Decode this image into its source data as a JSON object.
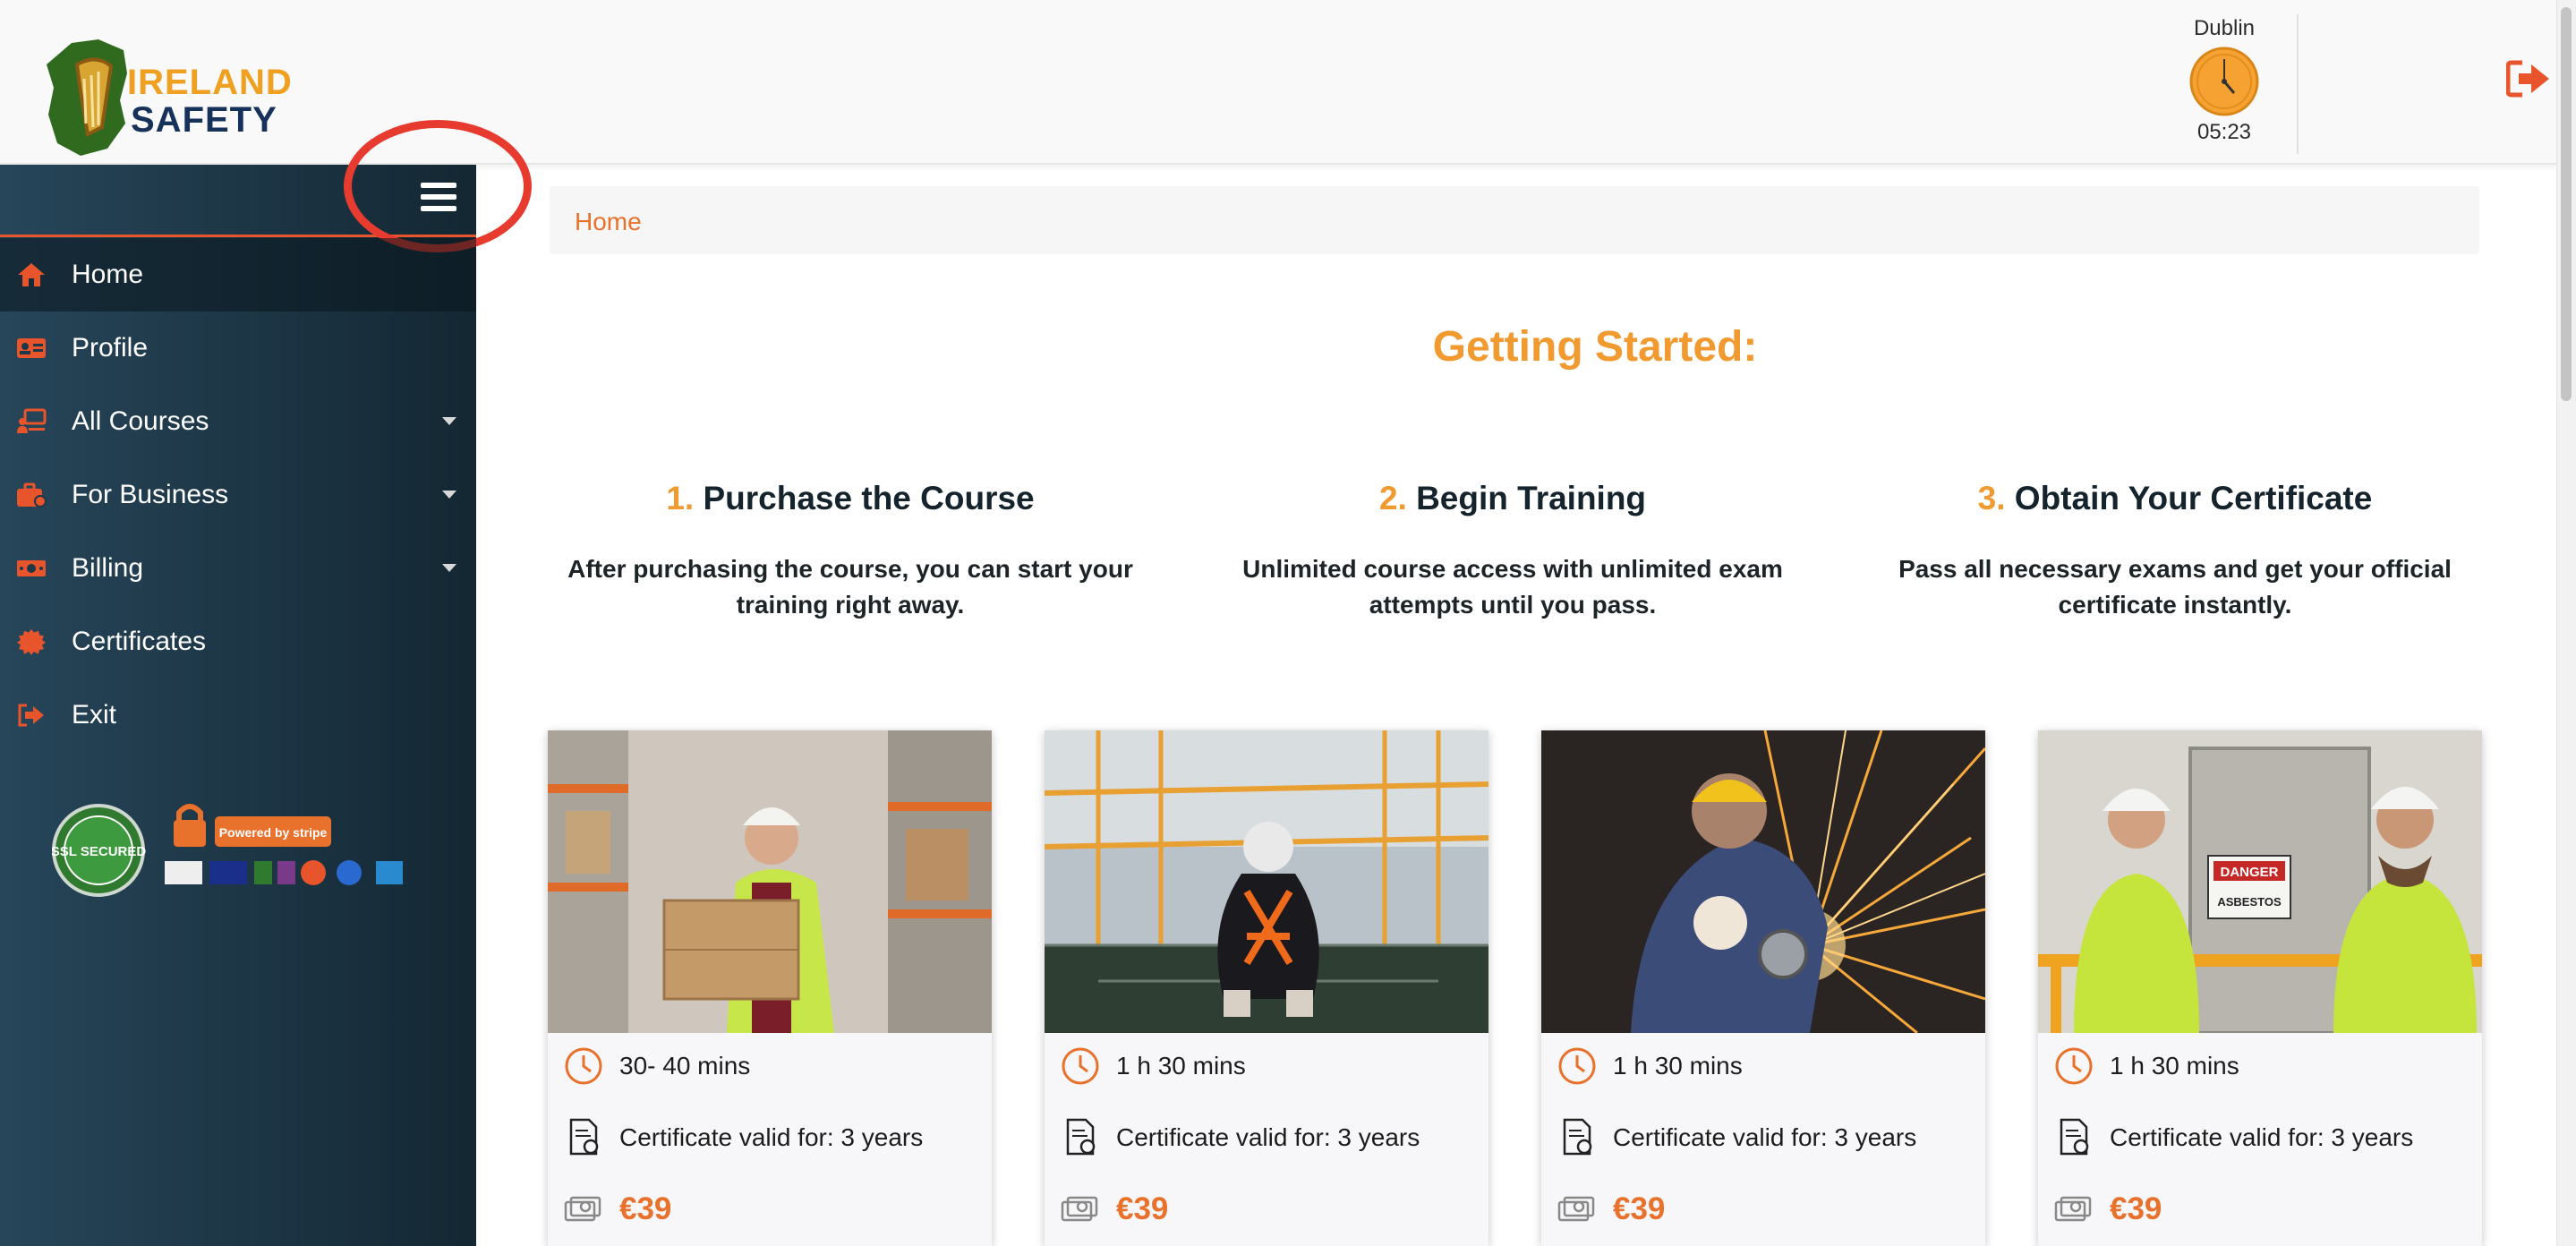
{
  "header": {
    "logo_text_1": "IRELAND",
    "logo_text_2": "SAFETY",
    "clock_city": "Dublin",
    "clock_time": "05:23"
  },
  "sidebar": {
    "items": [
      {
        "label": "Home",
        "icon": "home-icon",
        "has_dropdown": false,
        "active": true
      },
      {
        "label": "Profile",
        "icon": "id-card-icon",
        "has_dropdown": false
      },
      {
        "label": "All Courses",
        "icon": "laptop-user-icon",
        "has_dropdown": true
      },
      {
        "label": "For Business",
        "icon": "briefcase-icon",
        "has_dropdown": true
      },
      {
        "label": "Billing",
        "icon": "money-bill-icon",
        "has_dropdown": true
      },
      {
        "label": "Certificates",
        "icon": "certificate-icon",
        "has_dropdown": false
      },
      {
        "label": "Exit",
        "icon": "sign-out-icon",
        "has_dropdown": false
      }
    ],
    "badges": {
      "ssl_text": "SSL SECURED",
      "stripe_text": "Powered by stripe"
    }
  },
  "breadcrumb": {
    "label": "Home"
  },
  "getting_started": {
    "title": "Getting Started:",
    "steps": [
      {
        "num": "1.",
        "title": "Purchase the Course",
        "desc": "After purchasing the course, you can start your training right away."
      },
      {
        "num": "2.",
        "title": "Begin Training",
        "desc": "Unlimited course access with unlimited exam attempts until you pass."
      },
      {
        "num": "3.",
        "title": "Obtain Your Certificate",
        "desc": "Pass all necessary exams and get your official certificate instantly."
      }
    ]
  },
  "courses": [
    {
      "duration": "30- 40 mins",
      "validity": "Certificate valid for: 3 years",
      "price": "€39",
      "image": "warehouse worker carrying boxes"
    },
    {
      "duration": "1 h 30 mins",
      "validity": "Certificate valid for: 3 years",
      "price": "€39",
      "image": "worker in safety harness on walkway"
    },
    {
      "duration": "1 h 30 mins",
      "validity": "Certificate valid for: 3 years",
      "price": "€39",
      "image": "welder grinding with sparks"
    },
    {
      "duration": "1 h 30 mins",
      "validity": "Certificate valid for: 3 years",
      "price": "€39",
      "image": "two workers at asbestos danger door"
    }
  ],
  "image_text": {
    "danger_sign": "DANGER",
    "asbestos_sign": "ASBESTOS"
  },
  "colors": {
    "accent_orange": "#e8712c",
    "title_orange": "#f09a30",
    "sidebar_dark": "#1e3848",
    "highlight_red": "#e63b2e"
  }
}
